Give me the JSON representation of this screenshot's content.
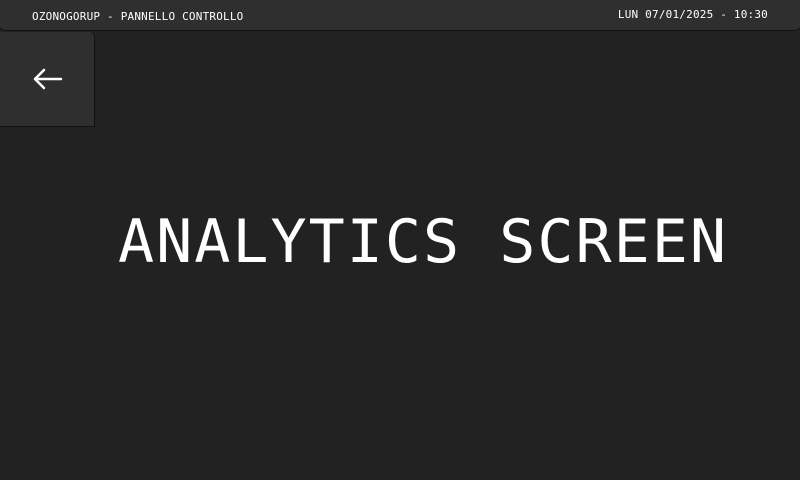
{
  "status_bar": {
    "app_title": "OZONOGORUP - PANNELLO CONTROLLO",
    "datetime": "LUN 07/01/2025 - 10:30"
  },
  "back_button": {
    "icon": "arrow-left-icon"
  },
  "main": {
    "title": "ANALYTICS SCREEN"
  },
  "colors": {
    "background": "#222222",
    "panel": "#2f2f2f",
    "text": "#ffffff"
  }
}
